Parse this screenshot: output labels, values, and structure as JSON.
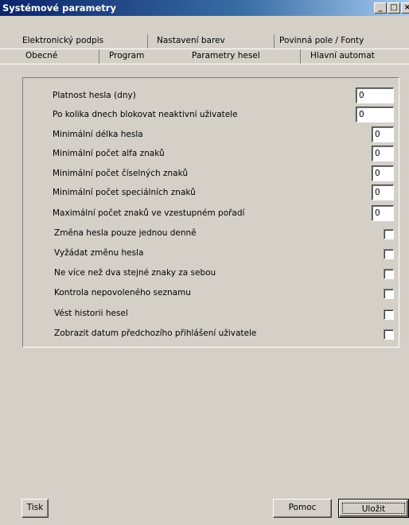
{
  "window": {
    "title": "Systémové parametry",
    "minimize_glyph": "_",
    "maximize_glyph": "□",
    "close_glyph": "×"
  },
  "tabs": {
    "row_back": [
      "Elektronický podpis",
      "Nastavení barev",
      "Povinná pole / Fonty"
    ],
    "row_front": [
      "Obecné",
      "Program",
      "Parametry hesel",
      "Hlavní automat"
    ],
    "selected": "Parametry hesel"
  },
  "numeric_fields": [
    {
      "label": "Platnost hesla (dny)",
      "value": "0"
    },
    {
      "label": "Po kolika dnech blokovat neaktivní uživatele",
      "value": "0"
    },
    {
      "label": "Minimální délka hesla",
      "value": "0"
    },
    {
      "label": "Minimální počet alfa znaků",
      "value": "0"
    },
    {
      "label": "Minimální počet číselných znaků",
      "value": "0"
    },
    {
      "label": "Minimální počet speciálních znaků",
      "value": "0"
    },
    {
      "label": "Maximální počet znaků ve vzestupném pořadí",
      "value": "0"
    }
  ],
  "checkboxes": [
    {
      "label": "Změna hesla pouze jednou denně",
      "checked": false
    },
    {
      "label": "Vyžádat změnu hesla",
      "checked": false
    },
    {
      "label": "Ne více než dva stejné znaky za sebou",
      "checked": false
    },
    {
      "label": "Kontrola nepovoleného seznamu",
      "checked": false
    },
    {
      "label": "Vést historii hesel",
      "checked": false
    },
    {
      "label": "Zobrazit datum předchozího přihlášení uživatele",
      "checked": false
    }
  ],
  "buttons": {
    "print": "Tisk",
    "help": "Pomoc",
    "save": "Uložit"
  }
}
